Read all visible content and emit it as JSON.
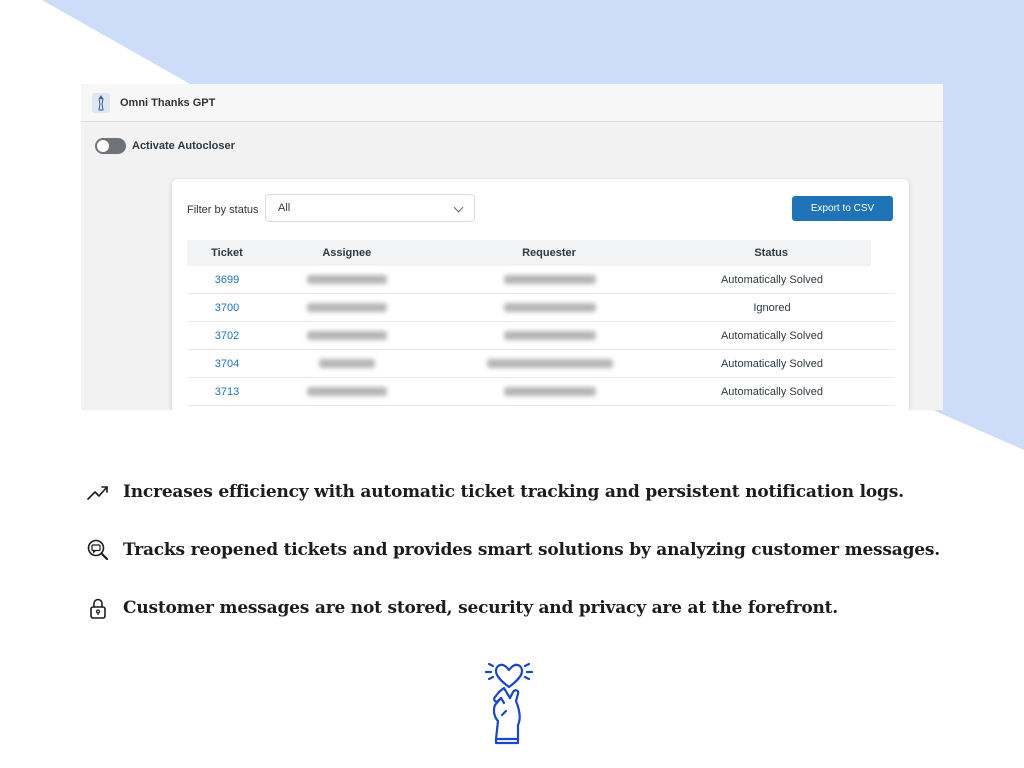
{
  "colors": {
    "background_shape": "#cddcf8",
    "accent": "#1f73b7",
    "icon_blue": "#1a47c2"
  },
  "app": {
    "title": "Omni Thanks GPT",
    "toggle_label": "Activate Autocloser",
    "toggle_on": false,
    "filter": {
      "label": "Filter by status",
      "selected": "All"
    },
    "export_label": "Export to CSV",
    "table": {
      "headers": [
        "Ticket",
        "Assignee",
        "Requester",
        "Status"
      ],
      "rows": [
        {
          "ticket": "3699",
          "status": "Automatically Solved"
        },
        {
          "ticket": "3700",
          "status": "Ignored"
        },
        {
          "ticket": "3702",
          "status": "Automatically Solved"
        },
        {
          "ticket": "3704",
          "status": "Automatically Solved"
        },
        {
          "ticket": "3713",
          "status": "Automatically Solved"
        }
      ]
    }
  },
  "features": [
    {
      "icon": "trending-up-icon",
      "text": "Increases efficiency with automatic ticket tracking and persistent notification logs."
    },
    {
      "icon": "magnifier-message-icon",
      "text": "Tracks reopened tickets and provides smart solutions by analyzing customer messages."
    },
    {
      "icon": "lock-icon",
      "text": "Customer messages are not stored, security and privacy are at the forefront."
    }
  ],
  "bottom_icon": "heart-hand-icon"
}
